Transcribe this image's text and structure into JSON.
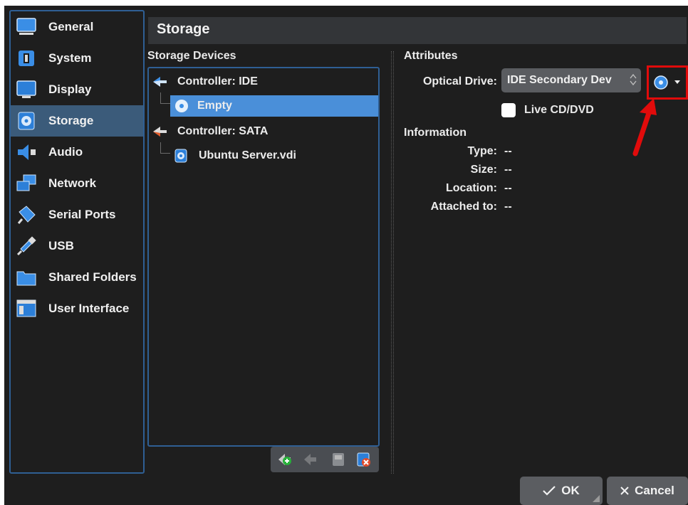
{
  "sidebar": {
    "items": [
      {
        "label": "General",
        "icon": "general-icon"
      },
      {
        "label": "System",
        "icon": "system-icon"
      },
      {
        "label": "Display",
        "icon": "display-icon"
      },
      {
        "label": "Storage",
        "icon": "storage-icon",
        "selected": true
      },
      {
        "label": "Audio",
        "icon": "audio-icon"
      },
      {
        "label": "Network",
        "icon": "network-icon"
      },
      {
        "label": "Serial Ports",
        "icon": "serial-ports-icon"
      },
      {
        "label": "USB",
        "icon": "usb-icon"
      },
      {
        "label": "Shared Folders",
        "icon": "shared-folders-icon"
      },
      {
        "label": "User Interface",
        "icon": "user-interface-icon"
      }
    ]
  },
  "header": {
    "title": "Storage"
  },
  "storage_devices": {
    "label": "Storage Devices",
    "tree": [
      {
        "label": "Controller: IDE",
        "icon": "ide-controller-icon"
      },
      {
        "label": "Empty",
        "icon": "optical-disc-icon",
        "selected": true
      },
      {
        "label": "Controller: SATA",
        "icon": "sata-controller-icon"
      },
      {
        "label": "Ubuntu Server.vdi",
        "icon": "hard-disk-icon"
      }
    ]
  },
  "attributes": {
    "label": "Attributes",
    "optical_drive_label": "Optical Drive:",
    "optical_drive_value": "IDE Secondary Dev",
    "live_cd_label": "Live CD/DVD",
    "live_cd_checked": false
  },
  "information": {
    "label": "Information",
    "rows": [
      {
        "label": "Type:",
        "value": "--"
      },
      {
        "label": "Size:",
        "value": "--"
      },
      {
        "label": "Location:",
        "value": "--"
      },
      {
        "label": "Attached to:",
        "value": "--"
      }
    ]
  },
  "buttons": {
    "ok": "OK",
    "cancel": "Cancel"
  },
  "colors": {
    "highlight_box": "#e10b0b",
    "selection": "#4a8fd9",
    "sidebar_selection": "#3b5b7a"
  }
}
